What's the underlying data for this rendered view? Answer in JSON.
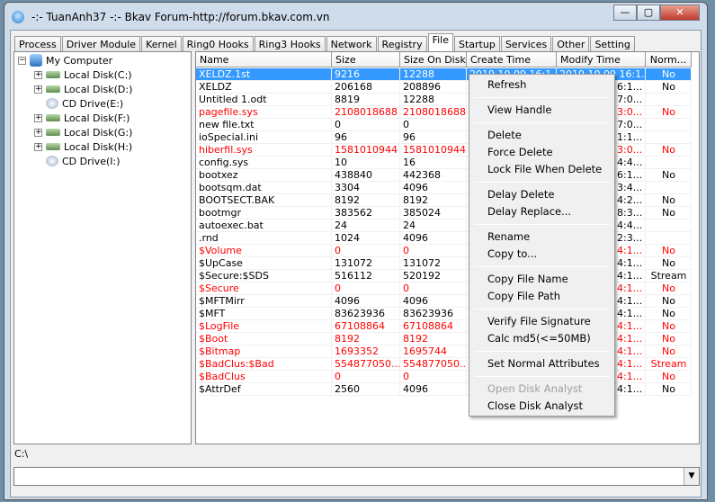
{
  "window": {
    "title": "-:- TuanAnh37 -:- Bkav Forum-http://forum.bkav.com.vn",
    "minimize": "—",
    "maximize": "▢",
    "close": "✕"
  },
  "tabs": [
    {
      "label": "Process"
    },
    {
      "label": "Driver Module"
    },
    {
      "label": "Kernel"
    },
    {
      "label": "Ring0 Hooks"
    },
    {
      "label": "Ring3 Hooks"
    },
    {
      "label": "Network"
    },
    {
      "label": "Registry"
    },
    {
      "label": "File",
      "active": true
    },
    {
      "label": "Startup"
    },
    {
      "label": "Services"
    },
    {
      "label": "Other"
    },
    {
      "label": "Setting"
    }
  ],
  "tree": {
    "root": "My Computer",
    "items": [
      {
        "label": "Local Disk(C:)",
        "type": "disk"
      },
      {
        "label": "Local Disk(D:)",
        "type": "disk"
      },
      {
        "label": "CD Drive(E:)",
        "type": "cd"
      },
      {
        "label": "Local Disk(F:)",
        "type": "disk"
      },
      {
        "label": "Local Disk(G:)",
        "type": "disk"
      },
      {
        "label": "Local Disk(H:)",
        "type": "disk"
      },
      {
        "label": "CD Drive(I:)",
        "type": "cd"
      }
    ]
  },
  "list": {
    "columns": [
      "Name",
      "Size",
      "Size On Disk",
      "Create Time",
      "Modify Time",
      "Norm..."
    ],
    "rows": [
      [
        "XELDZ.1st",
        "9216",
        "12288",
        "2019.10.09 16:1",
        "2019.10.09 16:1...",
        "No",
        "sel"
      ],
      [
        "XELDZ",
        "206168",
        "208896",
        "",
        "6:1...",
        "No",
        ""
      ],
      [
        "Untitled 1.odt",
        "8819",
        "12288",
        "",
        "7:0...",
        "",
        ""
      ],
      [
        "pagefile.sys",
        "2108018688",
        "2108018688",
        "",
        "3:0...",
        "No",
        "red"
      ],
      [
        "new file.txt",
        "0",
        "0",
        "",
        "7:0...",
        "",
        ""
      ],
      [
        "ioSpecial.ini",
        "96",
        "96",
        "",
        "1:1...",
        "",
        ""
      ],
      [
        "hiberfil.sys",
        "1581010944",
        "1581010944",
        "",
        "3:0...",
        "No",
        "red"
      ],
      [
        "config.sys",
        "10",
        "16",
        "",
        "4:4...",
        "",
        ""
      ],
      [
        "bootxez",
        "438840",
        "442368",
        "",
        "6:1...",
        "No",
        ""
      ],
      [
        "bootsqm.dat",
        "3304",
        "4096",
        "",
        "3:4...",
        "",
        ""
      ],
      [
        "BOOTSECT.BAK",
        "8192",
        "8192",
        "",
        "4:2...",
        "No",
        ""
      ],
      [
        "bootmgr",
        "383562",
        "385024",
        "",
        "8:3...",
        "No",
        ""
      ],
      [
        "autoexec.bat",
        "24",
        "24",
        "",
        "4:4...",
        "",
        ""
      ],
      [
        ".rnd",
        "1024",
        "4096",
        "",
        "2:3...",
        "",
        ""
      ],
      [
        "$Volume",
        "0",
        "0",
        "",
        "4:1...",
        "No",
        "red"
      ],
      [
        "$UpCase",
        "131072",
        "131072",
        "",
        "4:1...",
        "No",
        ""
      ],
      [
        "$Secure:$SDS",
        "516112",
        "520192",
        "",
        "4:1...",
        "Stream",
        ""
      ],
      [
        "$Secure",
        "0",
        "0",
        "",
        "4:1...",
        "No",
        "red"
      ],
      [
        "$MFTMirr",
        "4096",
        "4096",
        "",
        "4:1...",
        "No",
        ""
      ],
      [
        "$MFT",
        "83623936",
        "83623936",
        "",
        "4:1...",
        "No",
        ""
      ],
      [
        "$LogFile",
        "67108864",
        "67108864",
        "",
        "4:1...",
        "No",
        "red"
      ],
      [
        "$Boot",
        "8192",
        "8192",
        "",
        "4:1...",
        "No",
        "red"
      ],
      [
        "$Bitmap",
        "1693352",
        "1695744",
        "",
        "4:1...",
        "No",
        "red"
      ],
      [
        "$BadClus:$Bad",
        "554877050...",
        "554877050...",
        "",
        "4:1...",
        "Stream",
        "red"
      ],
      [
        "$BadClus",
        "0",
        "0",
        "",
        "4:1...",
        "No",
        "red"
      ],
      [
        "$AttrDef",
        "2560",
        "4096",
        "",
        "4:1...",
        "No",
        ""
      ]
    ]
  },
  "status": {
    "path": "C:\\"
  },
  "combo": {
    "value": "",
    "arrow": "▼"
  },
  "context_menu": [
    {
      "label": "Refresh"
    },
    {
      "sep": true
    },
    {
      "label": "View Handle"
    },
    {
      "sep": true
    },
    {
      "label": "Delete"
    },
    {
      "label": "Force Delete"
    },
    {
      "label": "Lock File When Delete"
    },
    {
      "sep": true
    },
    {
      "label": "Delay Delete"
    },
    {
      "label": "Delay Replace..."
    },
    {
      "sep": true
    },
    {
      "label": "Rename"
    },
    {
      "label": "Copy to..."
    },
    {
      "sep": true
    },
    {
      "label": "Copy File Name"
    },
    {
      "label": "Copy File Path"
    },
    {
      "sep": true
    },
    {
      "label": "Verify File Signature"
    },
    {
      "label": "Calc md5(<=50MB)"
    },
    {
      "sep": true
    },
    {
      "label": "Set Normal Attributes"
    },
    {
      "sep": true
    },
    {
      "label": "Open Disk Analyst",
      "disabled": true
    },
    {
      "label": "Close Disk Analyst"
    }
  ],
  "colors": {
    "selection": "#3399ff",
    "flagged": "#ff0000",
    "menu_bg": "#f0f0f0"
  }
}
